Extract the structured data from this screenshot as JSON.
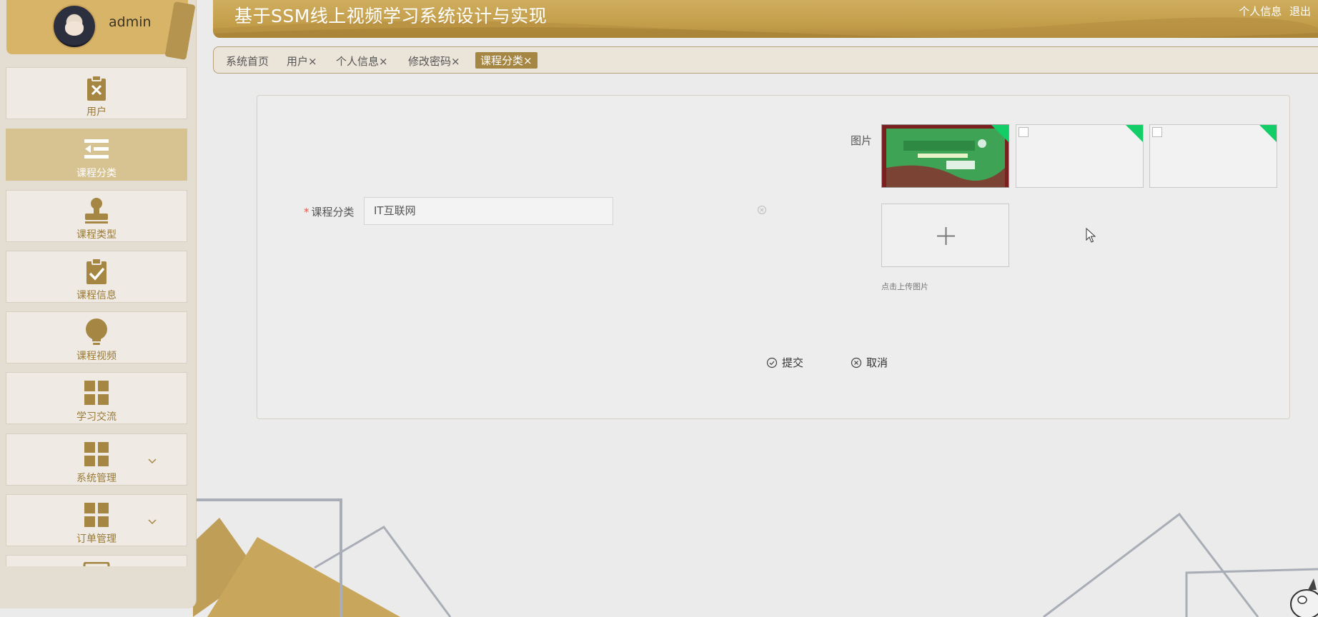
{
  "user": {
    "name": "admin"
  },
  "sidebar": {
    "items": [
      {
        "label": "用户",
        "icon": "clipboard-x-icon"
      },
      {
        "label": "课程分类",
        "icon": "list-indent-icon",
        "active": true
      },
      {
        "label": "课程类型",
        "icon": "stamp-icon"
      },
      {
        "label": "课程信息",
        "icon": "clipboard-check-icon"
      },
      {
        "label": "课程视频",
        "icon": "lightbulb-icon"
      },
      {
        "label": "学习交流",
        "icon": "grid-icon"
      },
      {
        "label": "系统管理",
        "icon": "grid-icon",
        "expandable": true
      },
      {
        "label": "订单管理",
        "icon": "grid-icon",
        "expandable": true
      }
    ]
  },
  "header": {
    "title": "基于SSM线上视频学习系统设计与实现",
    "profile_link": "个人信息",
    "logout_link": "退出"
  },
  "tabs": [
    {
      "label": "系统首页"
    },
    {
      "label": "用户",
      "closable": true
    },
    {
      "label": "个人信息",
      "closable": true
    },
    {
      "label": "修改密码",
      "closable": true
    },
    {
      "label": "课程分类",
      "closable": true,
      "active": true
    }
  ],
  "close_glyph": "×",
  "form": {
    "category_label": "课程分类",
    "category_value": "IT互联网",
    "image_label": "图片",
    "upload_tip": "点击上传图片",
    "images": [
      {
        "kind": "book-cover"
      },
      {
        "kind": "broken"
      },
      {
        "kind": "broken"
      }
    ],
    "submit_label": "提交",
    "cancel_label": "取消"
  },
  "colors": {
    "accent": "#a58743",
    "header": "#c29c48",
    "active_menu": "#d7c391",
    "success_corner": "#13ce66",
    "required": "#e0574e"
  }
}
